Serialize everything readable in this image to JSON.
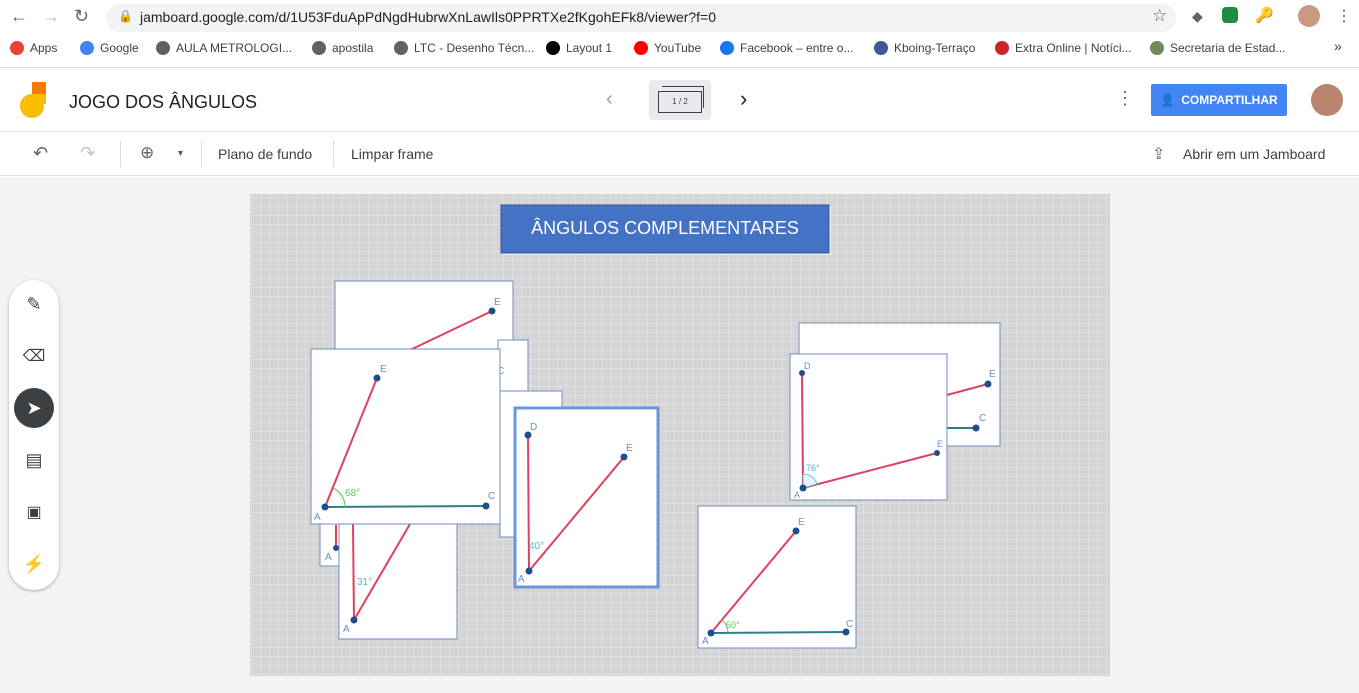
{
  "browser": {
    "url": "jamboard.google.com/d/1U53FduApPdNgdHubrwXnLawIls0PPRTXe2fKgohEFk8/viewer?f=0",
    "bookmarks": [
      {
        "label": "Apps",
        "icon": "apps-grid-icon",
        "color": "#ea4335"
      },
      {
        "label": "Google",
        "icon": "google-icon",
        "color": "#4285f4"
      },
      {
        "label": "AULA METROLOGI...",
        "icon": "globe-icon",
        "color": "#5f6368"
      },
      {
        "label": "apostila",
        "icon": "globe-icon",
        "color": "#5f6368"
      },
      {
        "label": "LTC - Desenho Técn...",
        "icon": "globe-icon",
        "color": "#5f6368"
      },
      {
        "label": "Layout 1",
        "icon": "m-icon",
        "color": "#000000"
      },
      {
        "label": "YouTube",
        "icon": "youtube-icon",
        "color": "#ff0000"
      },
      {
        "label": "Facebook – entre o...",
        "icon": "facebook-icon",
        "color": "#1877f2"
      },
      {
        "label": "Kboing-Terraço",
        "icon": "k-icon",
        "color": "#3b5998"
      },
      {
        "label": "Extra Online | Notíci...",
        "icon": "extra-icon",
        "color": "#c62828"
      },
      {
        "label": "Secretaria de Estad...",
        "icon": "seal-icon",
        "color": "#6d8b5a"
      }
    ],
    "more": "»"
  },
  "app": {
    "title": "JOGO DOS ÂNGULOS",
    "frame_indicator": "1 / 2",
    "share_label": "COMPARTILHAR",
    "accent": "#4285f4"
  },
  "toolbar": {
    "background": "Plano de fundo",
    "clear": "Limpar frame",
    "open": "Abrir em um Jamboard"
  },
  "board": {
    "title": "ÂNGULOS COMPLEMENTARES",
    "title_color": "#4472c4",
    "labels": {
      "E": "E",
      "C": "C",
      "A": "A",
      "D": "D"
    },
    "angles": {
      "a68": "68°",
      "a31": "31°",
      "a40": "40°",
      "a76": "76°",
      "a50": "50°"
    }
  }
}
